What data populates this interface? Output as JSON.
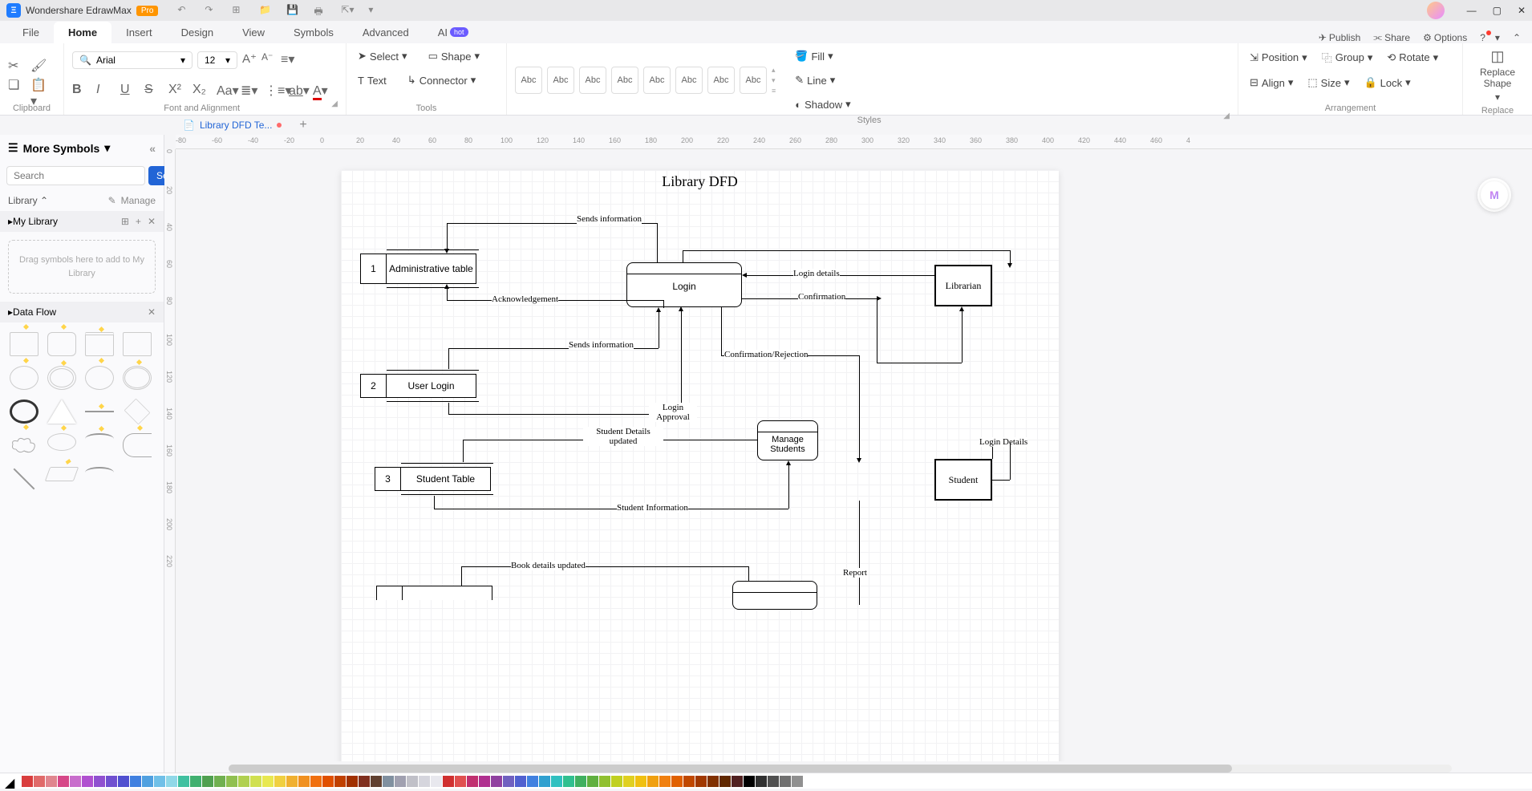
{
  "app": {
    "title": "Wondershare EdrawMax",
    "badge": "Pro"
  },
  "menubar": {
    "tabs": [
      "File",
      "Home",
      "Insert",
      "Design",
      "View",
      "Symbols",
      "Advanced",
      "AI"
    ],
    "active": 1,
    "hot": "hot",
    "right": {
      "publish": "Publish",
      "share": "Share",
      "options": "Options"
    }
  },
  "ribbon": {
    "clipboard": {
      "label": "Clipboard"
    },
    "font": {
      "name": "Arial",
      "size": "12",
      "label": "Font and Alignment"
    },
    "tools": {
      "select": "Select",
      "shape": "Shape",
      "text": "Text",
      "connector": "Connector",
      "label": "Tools"
    },
    "styles": {
      "sample": "Abc",
      "label": "Styles",
      "fill": "Fill",
      "line": "Line",
      "shadow": "Shadow"
    },
    "arrange": {
      "position": "Position",
      "group": "Group",
      "rotate": "Rotate",
      "align": "Align",
      "size": "Size",
      "lock": "Lock",
      "label": "Arrangement"
    },
    "replace": {
      "btn": "Replace Shape",
      "label": "Replace"
    }
  },
  "doctab": {
    "name": "Library DFD Te..."
  },
  "leftpanel": {
    "title": "More Symbols",
    "search_ph": "Search",
    "search_btn": "Search",
    "library": "Library",
    "manage": "Manage",
    "mylib": "My Library",
    "hint": "Drag symbols here to add to My Library",
    "dataflow": "Data Flow"
  },
  "ruler_h": [
    "-80",
    "-60",
    "-40",
    "-20",
    "0",
    "20",
    "40",
    "60",
    "80",
    "100",
    "120",
    "140",
    "160",
    "180",
    "200",
    "220",
    "240",
    "260",
    "280",
    "300",
    "320",
    "340",
    "360",
    "380",
    "400",
    "420",
    "440",
    "460",
    "4"
  ],
  "ruler_v": [
    "0",
    "20",
    "40",
    "60",
    "80",
    "100",
    "120",
    "140",
    "160",
    "180",
    "200",
    "220"
  ],
  "diagram": {
    "title": "Library DFD",
    "p1": {
      "id": "1",
      "name": "Administrative table"
    },
    "p2": {
      "id": "2",
      "name": "User Login"
    },
    "p3": {
      "id": "3",
      "name": "Student Table"
    },
    "login": "Login",
    "manage_students": "Manage Students",
    "librarian": "Librarian",
    "student": "Student",
    "labels": {
      "sends1": "Sends information",
      "ack": "Acknowledgement",
      "sends2": "Sends information",
      "login_details": "Login details",
      "confirmation": "Confirmation",
      "conf_rej": "Confirmation/Rejection",
      "login_approval": "Login Approval",
      "student_updated": "Student Details updated",
      "student_info": "Student Information",
      "login_details2": "Login Details",
      "book_updated": "Book details updated",
      "report": "Report"
    }
  },
  "swatches": [
    "#d93d3d",
    "#e06a6a",
    "#e0868f",
    "#d64788",
    "#c86dcc",
    "#b050d0",
    "#9050d0",
    "#7050d0",
    "#5050d0",
    "#4080e0",
    "#50a0e0",
    "#70c0e8",
    "#90d8e8",
    "#40c0a0",
    "#40b070",
    "#50a050",
    "#70b050",
    "#90c050",
    "#b0d050",
    "#d0e050",
    "#e8e850",
    "#f0d040",
    "#f0b030",
    "#f09020",
    "#f07010",
    "#e05000",
    "#c04000",
    "#a03000",
    "#803020",
    "#604030",
    "#8090a0",
    "#a0a0b0",
    "#c0c0c8",
    "#d5d5dd",
    "#e8e8ee",
    "#d03030",
    "#e05050",
    "#c03070",
    "#b03090",
    "#9040a0",
    "#7060c0",
    "#5060d0",
    "#4080e0",
    "#30a0d0",
    "#30c0c0",
    "#30c090",
    "#40b060",
    "#60b040",
    "#90c030",
    "#c0d020",
    "#e0d020",
    "#f0c010",
    "#f0a010",
    "#f08010",
    "#e06000",
    "#c04800",
    "#a03800",
    "#803000",
    "#602800",
    "#502020",
    "#000000",
    "#303030",
    "#505050",
    "#707070",
    "#909090",
    "#ffffff"
  ]
}
